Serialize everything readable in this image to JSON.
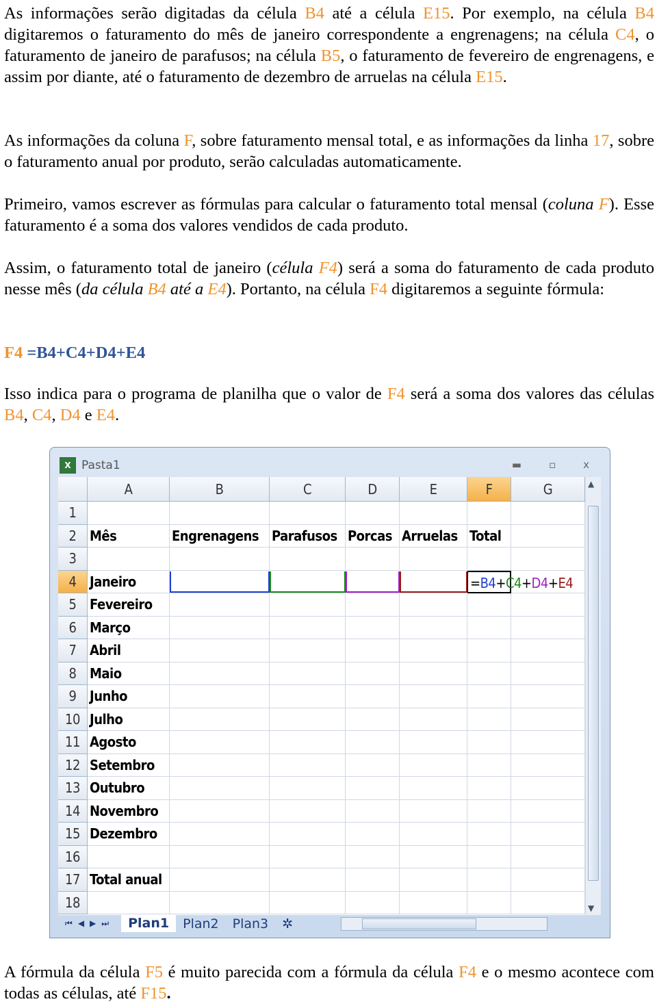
{
  "paragraphs": [
    {
      "segments": [
        {
          "t": "As informações serão digitadas da célula "
        },
        {
          "t": "B4",
          "hl": true
        },
        {
          "t": " até a célula "
        },
        {
          "t": "E15",
          "hl": true
        },
        {
          "t": ". Por exemplo, na célula "
        },
        {
          "t": "B4",
          "hl": true
        },
        {
          "t": " digitaremos o faturamento do mês de janeiro correspondente a engrenagens; na célula "
        },
        {
          "t": "C4",
          "hl": true
        },
        {
          "t": ", o faturamento de janeiro de parafusos; na célula "
        },
        {
          "t": "B5",
          "hl": true
        },
        {
          "t": ", o faturamento de fevereiro de engrenagens, e assim por diante, até o faturamento de dezembro de arruelas na célula "
        },
        {
          "t": "E15",
          "hl": true
        },
        {
          "t": "."
        }
      ]
    },
    {
      "segments": [
        {
          "t": "As informações da coluna "
        },
        {
          "t": "F",
          "hl": true
        },
        {
          "t": ", sobre faturamento mensal total, e as informações da linha "
        },
        {
          "t": "17",
          "hl": true
        },
        {
          "t": ", sobre o faturamento anual por produto, serão calculadas automaticamente."
        }
      ]
    },
    {
      "segments": [
        {
          "t": "Primeiro, vamos escrever as fórmulas para calcular o faturamento total mensal ("
        },
        {
          "t": "coluna ",
          "i": true
        },
        {
          "t": "F",
          "hl": true,
          "i": true
        },
        {
          "t": "). Esse faturamento é a soma dos valores vendidos de cada produto."
        }
      ]
    },
    {
      "segments": [
        {
          "t": "Assim, o faturamento total de janeiro ("
        },
        {
          "t": "célula ",
          "i": true
        },
        {
          "t": "F4",
          "hl": true,
          "i": true
        },
        {
          "t": ") será a soma do faturamento de cada produto nesse mês ("
        },
        {
          "t": "da célula ",
          "i": true
        },
        {
          "t": "B4",
          "hl": true,
          "i": true
        },
        {
          "t": " até a ",
          "i": true
        },
        {
          "t": "E4",
          "hl": true,
          "i": true
        },
        {
          "t": "). Portanto, na célula "
        },
        {
          "t": "F4",
          "hl": true
        },
        {
          "t": " digitaremos a seguinte fórmula:"
        }
      ]
    },
    {
      "segments": [
        {
          "t": "F4 ",
          "hl": true,
          "b": true
        },
        {
          "t": "=B4+C4+D4+E4",
          "b": true,
          "color": "#2f5597"
        }
      ]
    },
    {
      "segments": [
        {
          "t": "Isso indica para o programa de planilha que o valor de "
        },
        {
          "t": "F4",
          "hl": true
        },
        {
          "t": " será a soma dos valores das células "
        },
        {
          "t": "B4",
          "hl": true
        },
        {
          "t": ", "
        },
        {
          "t": "C4",
          "hl": true
        },
        {
          "t": ", "
        },
        {
          "t": "D4",
          "hl": true
        },
        {
          "t": " e "
        },
        {
          "t": "E4",
          "hl": true
        },
        {
          "t": "."
        }
      ]
    },
    {
      "segments": [
        {
          "t": "A fórmula da célula "
        },
        {
          "t": "F5",
          "hl": true
        },
        {
          "t": " é muito parecida com a fórmula da célula "
        },
        {
          "t": "F4",
          "hl": true
        },
        {
          "t": " e o mesmo acontece com todas as células, até "
        },
        {
          "t": "F15",
          "hl": true
        },
        {
          "t": ".",
          "b": true
        }
      ]
    }
  ],
  "spreadsheet": {
    "title": "Pasta1",
    "window_buttons": [
      "▬",
      "▫",
      "x"
    ],
    "columns": [
      "A",
      "B",
      "C",
      "D",
      "E",
      "F",
      "G"
    ],
    "selected_column": "F",
    "selected_row": "4",
    "rows": [
      {
        "n": "1",
        "cells": []
      },
      {
        "n": "2",
        "cells": [
          "Mês",
          "Engrenagens",
          "Parafusos",
          "Porcas",
          "Arruelas",
          "Total"
        ]
      },
      {
        "n": "3",
        "cells": []
      },
      {
        "n": "4",
        "cells": [
          "Janeiro"
        ]
      },
      {
        "n": "5",
        "cells": [
          "Fevereiro"
        ]
      },
      {
        "n": "6",
        "cells": [
          "Março"
        ]
      },
      {
        "n": "7",
        "cells": [
          "Abril"
        ]
      },
      {
        "n": "8",
        "cells": [
          "Maio"
        ]
      },
      {
        "n": "9",
        "cells": [
          "Junho"
        ]
      },
      {
        "n": "10",
        "cells": [
          "Julho"
        ]
      },
      {
        "n": "11",
        "cells": [
          "Agosto"
        ]
      },
      {
        "n": "12",
        "cells": [
          "Setembro"
        ]
      },
      {
        "n": "13",
        "cells": [
          "Outubro"
        ]
      },
      {
        "n": "14",
        "cells": [
          "Novembro"
        ]
      },
      {
        "n": "15",
        "cells": [
          "Dezembro"
        ]
      },
      {
        "n": "16",
        "cells": []
      },
      {
        "n": "17",
        "cells": [
          "Total anual"
        ]
      },
      {
        "n": "18",
        "cells": []
      }
    ],
    "formula_parts": [
      {
        "t": "=",
        "color": "#000000"
      },
      {
        "t": "B4",
        "color": "#1f3fd0"
      },
      {
        "t": "+",
        "color": "#000000"
      },
      {
        "t": "C4",
        "color": "#168a16"
      },
      {
        "t": "+",
        "color": "#000000"
      },
      {
        "t": "D4",
        "color": "#a020c0"
      },
      {
        "t": "+",
        "color": "#000000"
      },
      {
        "t": "E4",
        "color": "#9a1a1a"
      }
    ],
    "range_colors": [
      "#1f3fd0",
      "#168a16",
      "#a020c0",
      "#9a1a1a"
    ],
    "sheet_tabs": [
      "Plan1",
      "Plan2",
      "Plan3"
    ],
    "active_tab": "Plan1",
    "nav_buttons": [
      "⏮",
      "◀",
      "▶",
      "⏭"
    ]
  },
  "colors": {
    "highlight": "#f0932f",
    "formula": "#2f5597"
  }
}
